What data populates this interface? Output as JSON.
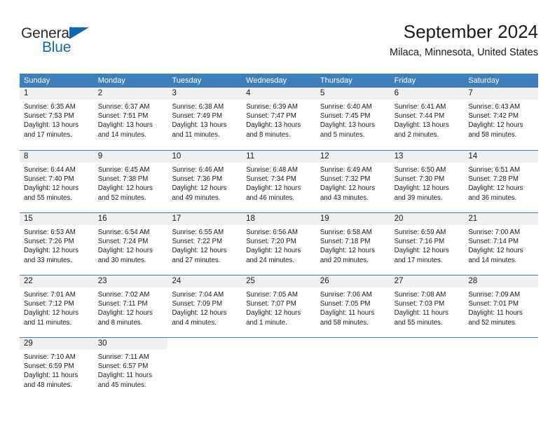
{
  "brand": {
    "name_part1": "General",
    "name_part2": "Blue",
    "color_dark": "#2b2b2b",
    "color_blue": "#1267b2"
  },
  "header": {
    "title": "September 2024",
    "subtitle": "Milaca, Minnesota, United States"
  },
  "theme": {
    "header_bar": "#3d7ebd",
    "daynum_band": "#f0f0f0",
    "text": "#1a1a1a"
  },
  "weekdays": [
    "Sunday",
    "Monday",
    "Tuesday",
    "Wednesday",
    "Thursday",
    "Friday",
    "Saturday"
  ],
  "weeks": [
    [
      {
        "day": "1",
        "sunrise": "Sunrise: 6:35 AM",
        "sunset": "Sunset: 7:53 PM",
        "daylight1": "Daylight: 13 hours",
        "daylight2": "and 17 minutes."
      },
      {
        "day": "2",
        "sunrise": "Sunrise: 6:37 AM",
        "sunset": "Sunset: 7:51 PM",
        "daylight1": "Daylight: 13 hours",
        "daylight2": "and 14 minutes."
      },
      {
        "day": "3",
        "sunrise": "Sunrise: 6:38 AM",
        "sunset": "Sunset: 7:49 PM",
        "daylight1": "Daylight: 13 hours",
        "daylight2": "and 11 minutes."
      },
      {
        "day": "4",
        "sunrise": "Sunrise: 6:39 AM",
        "sunset": "Sunset: 7:47 PM",
        "daylight1": "Daylight: 13 hours",
        "daylight2": "and 8 minutes."
      },
      {
        "day": "5",
        "sunrise": "Sunrise: 6:40 AM",
        "sunset": "Sunset: 7:45 PM",
        "daylight1": "Daylight: 13 hours",
        "daylight2": "and 5 minutes."
      },
      {
        "day": "6",
        "sunrise": "Sunrise: 6:41 AM",
        "sunset": "Sunset: 7:44 PM",
        "daylight1": "Daylight: 13 hours",
        "daylight2": "and 2 minutes."
      },
      {
        "day": "7",
        "sunrise": "Sunrise: 6:43 AM",
        "sunset": "Sunset: 7:42 PM",
        "daylight1": "Daylight: 12 hours",
        "daylight2": "and 58 minutes."
      }
    ],
    [
      {
        "day": "8",
        "sunrise": "Sunrise: 6:44 AM",
        "sunset": "Sunset: 7:40 PM",
        "daylight1": "Daylight: 12 hours",
        "daylight2": "and 55 minutes."
      },
      {
        "day": "9",
        "sunrise": "Sunrise: 6:45 AM",
        "sunset": "Sunset: 7:38 PM",
        "daylight1": "Daylight: 12 hours",
        "daylight2": "and 52 minutes."
      },
      {
        "day": "10",
        "sunrise": "Sunrise: 6:46 AM",
        "sunset": "Sunset: 7:36 PM",
        "daylight1": "Daylight: 12 hours",
        "daylight2": "and 49 minutes."
      },
      {
        "day": "11",
        "sunrise": "Sunrise: 6:48 AM",
        "sunset": "Sunset: 7:34 PM",
        "daylight1": "Daylight: 12 hours",
        "daylight2": "and 46 minutes."
      },
      {
        "day": "12",
        "sunrise": "Sunrise: 6:49 AM",
        "sunset": "Sunset: 7:32 PM",
        "daylight1": "Daylight: 12 hours",
        "daylight2": "and 43 minutes."
      },
      {
        "day": "13",
        "sunrise": "Sunrise: 6:50 AM",
        "sunset": "Sunset: 7:30 PM",
        "daylight1": "Daylight: 12 hours",
        "daylight2": "and 39 minutes."
      },
      {
        "day": "14",
        "sunrise": "Sunrise: 6:51 AM",
        "sunset": "Sunset: 7:28 PM",
        "daylight1": "Daylight: 12 hours",
        "daylight2": "and 36 minutes."
      }
    ],
    [
      {
        "day": "15",
        "sunrise": "Sunrise: 6:53 AM",
        "sunset": "Sunset: 7:26 PM",
        "daylight1": "Daylight: 12 hours",
        "daylight2": "and 33 minutes."
      },
      {
        "day": "16",
        "sunrise": "Sunrise: 6:54 AM",
        "sunset": "Sunset: 7:24 PM",
        "daylight1": "Daylight: 12 hours",
        "daylight2": "and 30 minutes."
      },
      {
        "day": "17",
        "sunrise": "Sunrise: 6:55 AM",
        "sunset": "Sunset: 7:22 PM",
        "daylight1": "Daylight: 12 hours",
        "daylight2": "and 27 minutes."
      },
      {
        "day": "18",
        "sunrise": "Sunrise: 6:56 AM",
        "sunset": "Sunset: 7:20 PM",
        "daylight1": "Daylight: 12 hours",
        "daylight2": "and 24 minutes."
      },
      {
        "day": "19",
        "sunrise": "Sunrise: 6:58 AM",
        "sunset": "Sunset: 7:18 PM",
        "daylight1": "Daylight: 12 hours",
        "daylight2": "and 20 minutes."
      },
      {
        "day": "20",
        "sunrise": "Sunrise: 6:59 AM",
        "sunset": "Sunset: 7:16 PM",
        "daylight1": "Daylight: 12 hours",
        "daylight2": "and 17 minutes."
      },
      {
        "day": "21",
        "sunrise": "Sunrise: 7:00 AM",
        "sunset": "Sunset: 7:14 PM",
        "daylight1": "Daylight: 12 hours",
        "daylight2": "and 14 minutes."
      }
    ],
    [
      {
        "day": "22",
        "sunrise": "Sunrise: 7:01 AM",
        "sunset": "Sunset: 7:12 PM",
        "daylight1": "Daylight: 12 hours",
        "daylight2": "and 11 minutes."
      },
      {
        "day": "23",
        "sunrise": "Sunrise: 7:02 AM",
        "sunset": "Sunset: 7:11 PM",
        "daylight1": "Daylight: 12 hours",
        "daylight2": "and 8 minutes."
      },
      {
        "day": "24",
        "sunrise": "Sunrise: 7:04 AM",
        "sunset": "Sunset: 7:09 PM",
        "daylight1": "Daylight: 12 hours",
        "daylight2": "and 4 minutes."
      },
      {
        "day": "25",
        "sunrise": "Sunrise: 7:05 AM",
        "sunset": "Sunset: 7:07 PM",
        "daylight1": "Daylight: 12 hours",
        "daylight2": "and 1 minute."
      },
      {
        "day": "26",
        "sunrise": "Sunrise: 7:06 AM",
        "sunset": "Sunset: 7:05 PM",
        "daylight1": "Daylight: 11 hours",
        "daylight2": "and 58 minutes."
      },
      {
        "day": "27",
        "sunrise": "Sunrise: 7:08 AM",
        "sunset": "Sunset: 7:03 PM",
        "daylight1": "Daylight: 11 hours",
        "daylight2": "and 55 minutes."
      },
      {
        "day": "28",
        "sunrise": "Sunrise: 7:09 AM",
        "sunset": "Sunset: 7:01 PM",
        "daylight1": "Daylight: 11 hours",
        "daylight2": "and 52 minutes."
      }
    ],
    [
      {
        "day": "29",
        "sunrise": "Sunrise: 7:10 AM",
        "sunset": "Sunset: 6:59 PM",
        "daylight1": "Daylight: 11 hours",
        "daylight2": "and 48 minutes."
      },
      {
        "day": "30",
        "sunrise": "Sunrise: 7:11 AM",
        "sunset": "Sunset: 6:57 PM",
        "daylight1": "Daylight: 11 hours",
        "daylight2": "and 45 minutes."
      },
      {
        "day": "",
        "sunrise": "",
        "sunset": "",
        "daylight1": "",
        "daylight2": ""
      },
      {
        "day": "",
        "sunrise": "",
        "sunset": "",
        "daylight1": "",
        "daylight2": ""
      },
      {
        "day": "",
        "sunrise": "",
        "sunset": "",
        "daylight1": "",
        "daylight2": ""
      },
      {
        "day": "",
        "sunrise": "",
        "sunset": "",
        "daylight1": "",
        "daylight2": ""
      },
      {
        "day": "",
        "sunrise": "",
        "sunset": "",
        "daylight1": "",
        "daylight2": ""
      }
    ]
  ]
}
